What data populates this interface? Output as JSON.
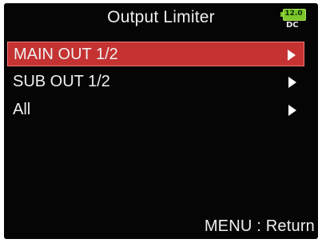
{
  "screen": {
    "title": "Output Limiter",
    "battery": {
      "level_text": "12.0",
      "power_label": "DC",
      "color": "#7cc52b"
    }
  },
  "menu": {
    "items": [
      {
        "label": "MAIN OUT 1/2",
        "selected": true,
        "icon": "chevron-right-icon"
      },
      {
        "label": "SUB OUT 1/2",
        "selected": false,
        "icon": "chevron-right-icon"
      },
      {
        "label": "All",
        "selected": false,
        "icon": "chevron-right-icon"
      }
    ]
  },
  "footer": {
    "hint": "MENU : Return"
  },
  "colors": {
    "background": "#050505",
    "selection": "#c53232",
    "text": "#f0f0f0"
  }
}
